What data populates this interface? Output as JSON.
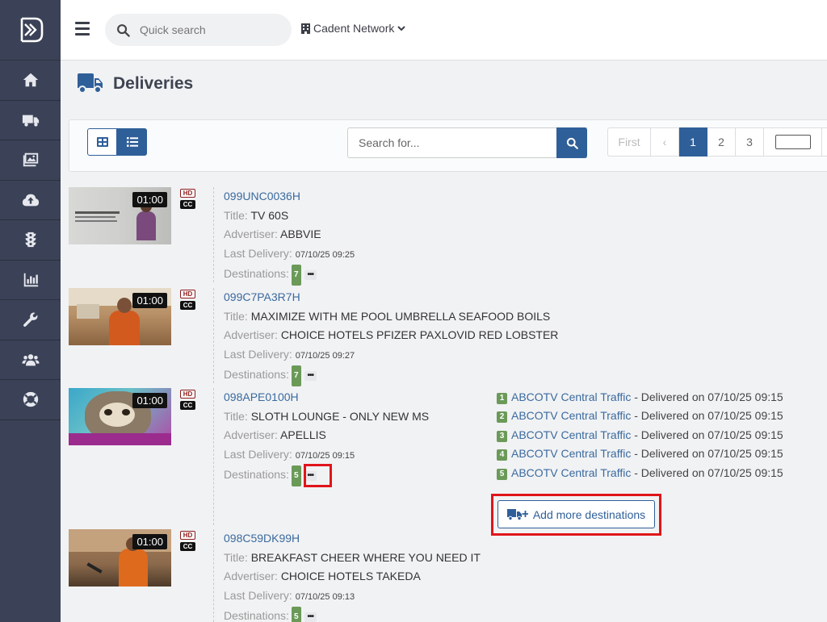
{
  "topbar": {
    "search_placeholder": "Quick search",
    "network": "Cadent Network"
  },
  "sidebar": {
    "items": [
      "home-icon",
      "truck-icon",
      "media-icon",
      "cloud-upload-icon",
      "traffic-light-icon",
      "chart-icon",
      "wrench-icon",
      "users-icon",
      "life-ring-icon"
    ]
  },
  "page": {
    "title": "Deliveries"
  },
  "toolbar": {
    "search_placeholder": "Search for...",
    "pager": {
      "first": "First",
      "prev": "‹",
      "pages": [
        "1",
        "2",
        "3"
      ],
      "active": "1"
    }
  },
  "labels": {
    "title": "Title:",
    "advertiser": "Advertiser:",
    "last_delivery": "Last Delivery:",
    "destinations": "Destinations:",
    "hd": "HD",
    "cc": "CC",
    "more": "•••"
  },
  "rows": [
    {
      "code": "099UNC0036H",
      "title": "TV 60S",
      "advertiser": "ABBVIE",
      "last_delivery": "07/10/25 09:25",
      "destinations": "7",
      "duration": "01:00"
    },
    {
      "code": "099C7PA3R7H",
      "title": "MAXIMIZE WITH ME POOL UMBRELLA SEAFOOD BOILS",
      "advertiser": "CHOICE HOTELS PFIZER PAXLOVID RED LOBSTER",
      "last_delivery": "07/10/25 09:27",
      "destinations": "7",
      "duration": "01:00"
    },
    {
      "code": "098APE0100H",
      "title": "SLOTH LOUNGE - ONLY NEW MS",
      "advertiser": "APELLIS",
      "last_delivery": "07/10/25 09:15",
      "destinations": "5",
      "duration": "01:00"
    },
    {
      "code": "098C59DK99H",
      "title": "BREAKFAST CHEER WHERE YOU NEED IT",
      "advertiser": "CHOICE HOTELS TAKEDA",
      "last_delivery": "07/10/25 09:13",
      "destinations": "5",
      "duration": "01:00"
    }
  ],
  "destination_list": [
    {
      "n": "1",
      "station": "ABCOTV Central Traffic",
      "status": " - Delivered on 07/10/25 09:15"
    },
    {
      "n": "2",
      "station": "ABCOTV Central Traffic",
      "status": " - Delivered on 07/10/25 09:15"
    },
    {
      "n": "3",
      "station": "ABCOTV Central Traffic",
      "status": " - Delivered on 07/10/25 09:15"
    },
    {
      "n": "4",
      "station": "ABCOTV Central Traffic",
      "status": " - Delivered on 07/10/25 09:15"
    },
    {
      "n": "5",
      "station": "ABCOTV Central Traffic",
      "status": " - Delivered on 07/10/25 09:15"
    }
  ],
  "add_destinations_label": "Add more destinations",
  "colors": {
    "sidebar": "#3b4257",
    "primary": "#2f5f99",
    "count_badge": "#6b9a58",
    "highlight": "#e0151a"
  }
}
